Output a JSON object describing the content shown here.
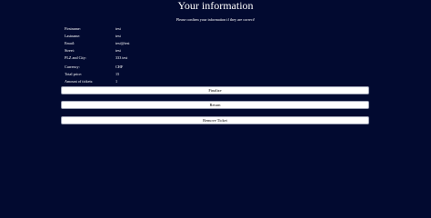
{
  "header": {
    "title": "Your information",
    "subtitle": "Please confirm your information if they are correct!"
  },
  "personal": [
    {
      "label": "Firstname:",
      "value": "test"
    },
    {
      "label": "Lastname:",
      "value": "test"
    },
    {
      "label": "Email:",
      "value": "test@test"
    },
    {
      "label": "Street:",
      "value": "test"
    },
    {
      "label": "PLZ and City:",
      "value": "333 test"
    }
  ],
  "order": [
    {
      "label": "Currency:",
      "value": "CHF"
    },
    {
      "label": "Total price:",
      "value": "15"
    },
    {
      "label": "Amount of tickets:",
      "value": "1"
    }
  ],
  "buttons": {
    "finalize": "Finalize",
    "return": "Return",
    "remove_ticket": "Remove Ticket"
  },
  "colors": {
    "background": "#020a30",
    "text": "#ffffff",
    "button_bg": "#ffffff"
  }
}
